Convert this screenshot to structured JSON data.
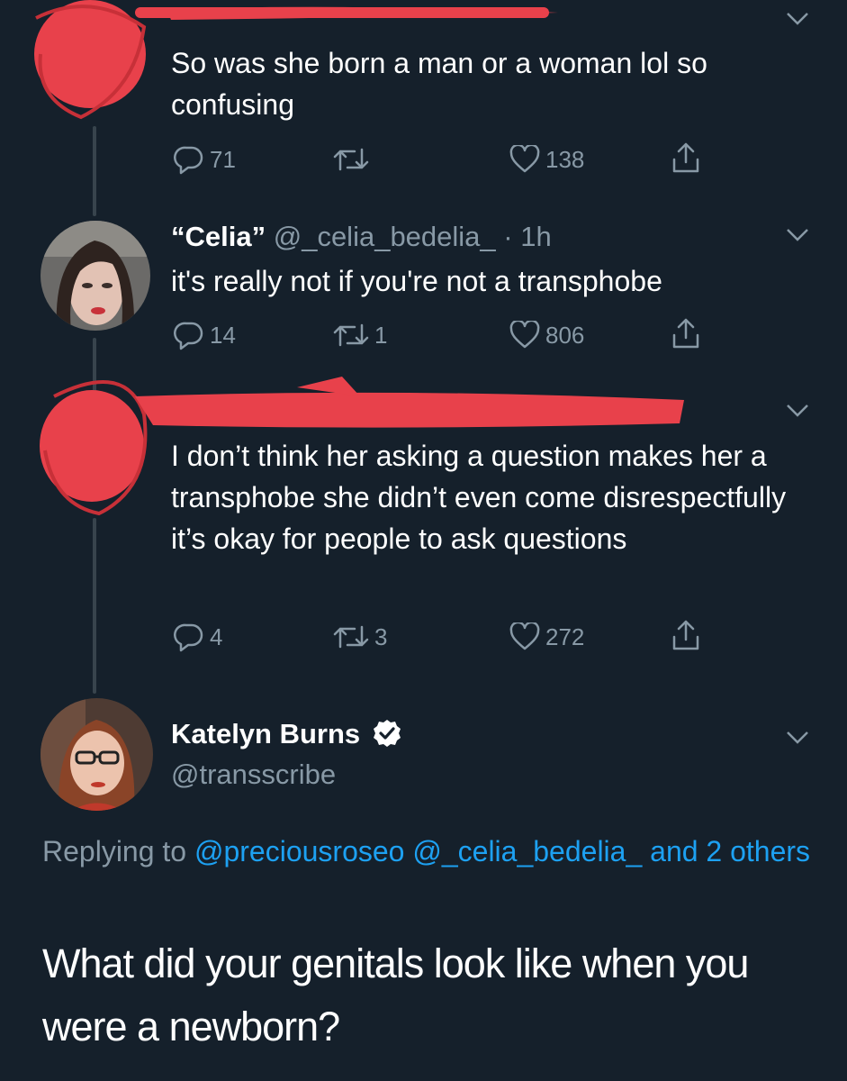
{
  "tweets": [
    {
      "text": "So was she born a man or a woman lol so confusing",
      "actions": {
        "replies": "71",
        "retweets": "",
        "likes": "138"
      }
    },
    {
      "display_name": "“Celia”",
      "handle": "@_celia_bedelia_",
      "time": "· 1h",
      "text": "it's really not if you're not a transphobe",
      "actions": {
        "replies": "14",
        "retweets": "1",
        "likes": "806"
      }
    },
    {
      "text": "I don’t think her asking a question makes her a transphobe she didn’t even come disrespectfully it’s okay for people to ask questions",
      "actions": {
        "replies": "4",
        "retweets": "3",
        "likes": "272"
      }
    }
  ],
  "main_tweet": {
    "display_name": "Katelyn Burns",
    "handle": "@transscribe",
    "replying_prefix": "Replying to",
    "mention_1": "@preciousroseo",
    "mention_2": "@_celia_bedelia_",
    "mention_3": "and 2 others",
    "text": "What did your genitals look like when you were a newborn?"
  },
  "colors": {
    "background": "#15202b",
    "muted": "#8899a6",
    "link": "#1da1f2",
    "redaction": "#e8414b"
  },
  "icons": [
    "reply-icon",
    "retweet-icon",
    "like-icon",
    "share-icon",
    "chevron-down-icon",
    "verified-badge-icon"
  ]
}
